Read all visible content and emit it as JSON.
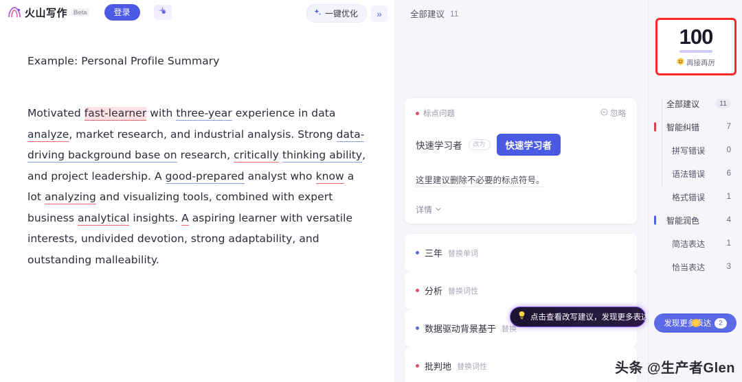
{
  "app": {
    "logo_text": "火山写作",
    "beta_label": "Beta",
    "login_label": "登录",
    "spark_icon": "sparkle-icon",
    "optimize_label": "一键优化",
    "optimize_icon": "sparkle-icon",
    "collapse_icon": "double-chevron-right-icon"
  },
  "document": {
    "title": "Example: Personal Profile Summary",
    "paragraph_segments": [
      {
        "text": "Motivated ",
        "style": "plain"
      },
      {
        "text": "fast-learner",
        "style": "err-red-hl"
      },
      {
        "text": " with ",
        "style": "plain"
      },
      {
        "text": "three-year",
        "style": "err-blue"
      },
      {
        "text": " experience in data ",
        "style": "plain"
      },
      {
        "text": "analyze",
        "style": "err-red"
      },
      {
        "text": ", market research, and industrial analysis. Strong ",
        "style": "plain"
      },
      {
        "text": "data-driving background base on",
        "style": "err-blue"
      },
      {
        "text": " research, ",
        "style": "plain"
      },
      {
        "text": "critically",
        "style": "err-red"
      },
      {
        "text": " ",
        "style": "plain"
      },
      {
        "text": "thinking ability",
        "style": "err-blue"
      },
      {
        "text": ", and project leadership. A ",
        "style": "plain"
      },
      {
        "text": "good-prepared",
        "style": "err-blue"
      },
      {
        "text": " analyst who ",
        "style": "plain"
      },
      {
        "text": "know",
        "style": "err-red"
      },
      {
        "text": " a lot ",
        "style": "plain"
      },
      {
        "text": "analyzing",
        "style": "err-red"
      },
      {
        "text": " and visualizing tools, combined with expert business ",
        "style": "plain"
      },
      {
        "text": "analytical",
        "style": "err-red"
      },
      {
        "text": " insights. ",
        "style": "plain"
      },
      {
        "text": "A",
        "style": "err-red"
      },
      {
        "text": " aspiring learner with versatile interests, undivided devotion, strong adaptability, and outstanding malleability.",
        "style": "plain"
      }
    ]
  },
  "suggestions_panel": {
    "header_label": "全部建议",
    "header_count": "11",
    "card": {
      "tag_label": "标点问题",
      "tag_color": "#e84a5f",
      "ignore_label": "忽略",
      "ignore_icon": "minus-circle-icon",
      "old_word": "快速学习者",
      "arrow_label": "改为",
      "new_word": "快速学习者",
      "description": "这里建议删除不必要的标点符号。",
      "more_label": "详情",
      "more_icon": "chevron-down-icon"
    },
    "rows": [
      {
        "word": "三年",
        "action": "替换单词",
        "dot_color": "#5b6ae0"
      },
      {
        "word": "分析",
        "action": "替换词性",
        "dot_color": "#e84a5f"
      },
      {
        "word": "数据驱动背景基于",
        "action": "替换",
        "dot_color": "#5b6ae0"
      },
      {
        "word": "批判地",
        "action": "替换词性",
        "dot_color": "#e84a5f"
      }
    ],
    "tooltip": {
      "text": "点击查看改写建议，发现更多表达",
      "icon": "lightbulb-icon"
    }
  },
  "stats_panel": {
    "score": "100",
    "score_sub": "再接再厉",
    "score_sub_icon": "smile-emoji",
    "score_border_color": "#fb2a2a",
    "items": [
      {
        "label": "全部建议",
        "value": "11",
        "level": "top",
        "bar": null,
        "pill": true
      },
      {
        "label": "智能纠错",
        "value": "7",
        "level": "top",
        "bar": "#e03c4e",
        "pill": false
      },
      {
        "label": "拼写错误",
        "value": "0",
        "level": "sub",
        "bar": null,
        "pill": false
      },
      {
        "label": "语法错误",
        "value": "6",
        "level": "sub",
        "bar": null,
        "pill": false
      },
      {
        "label": "格式错误",
        "value": "1",
        "level": "sub",
        "bar": null,
        "pill": false
      },
      {
        "label": "智能润色",
        "value": "4",
        "level": "top",
        "bar": "#4b63e6",
        "pill": false
      },
      {
        "label": "简洁表达",
        "value": "1",
        "level": "sub",
        "bar": null,
        "pill": false
      },
      {
        "label": "恰当表达",
        "value": "3",
        "level": "sub",
        "bar": null,
        "pill": false
      }
    ],
    "discover_label": "发现更多表达",
    "discover_badge": "2"
  },
  "watermark": "头条 @生产者Glen"
}
